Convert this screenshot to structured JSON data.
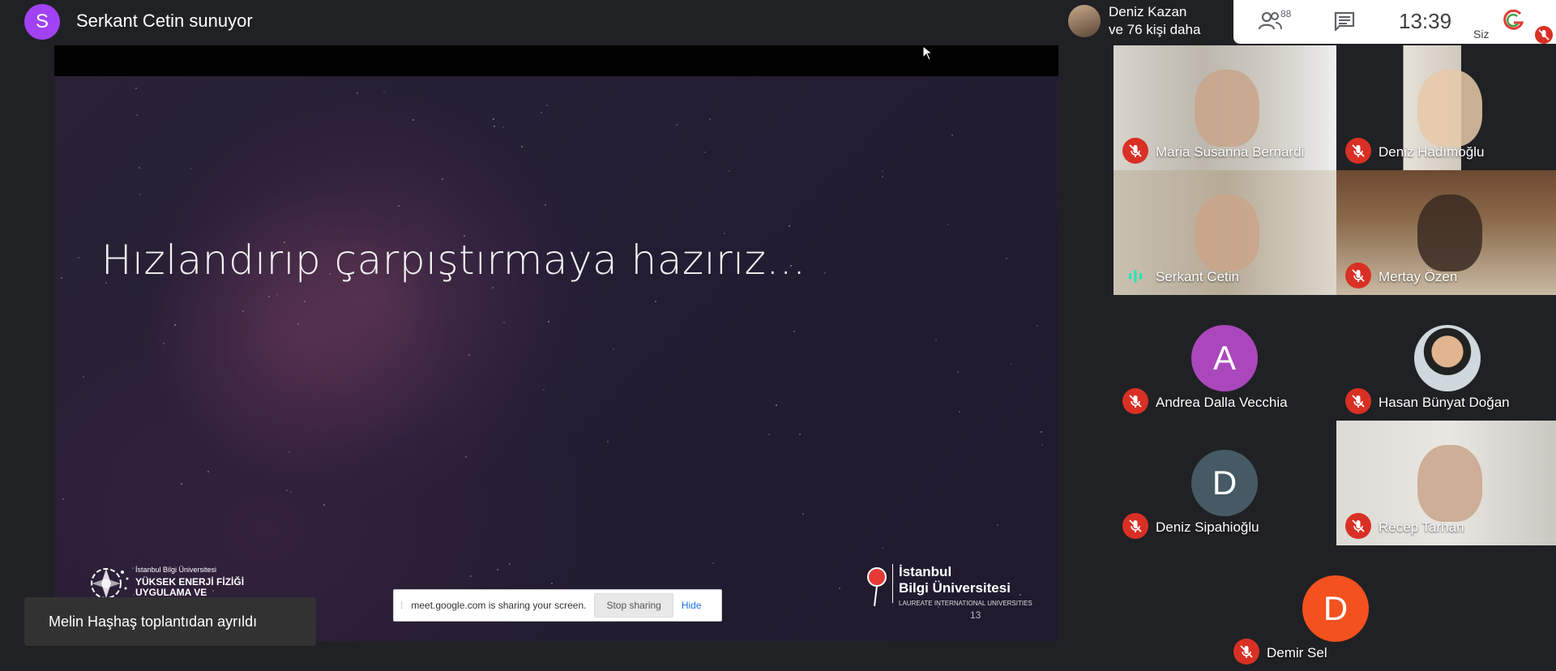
{
  "presenter": {
    "initial": "S",
    "title": "Serkant Cetin sunuyor"
  },
  "slide": {
    "heading": "Hızlandırıp çarpıştırmaya hazırız...",
    "left_logo": {
      "small": "İstanbul Bilgi Üniversitesi",
      "line1": "YÜKSEK ENERJİ FİZİĞİ",
      "line2": "UYGULAMA VE"
    },
    "right_logo": {
      "line1": "İstanbul",
      "line2": "Bilgi Üniversitesi",
      "line3": "LAUREATE INTERNATIONAL UNIVERSITIES"
    },
    "page_number": "13"
  },
  "share_bar": {
    "text": "meet.google.com is sharing your screen.",
    "stop_label": "Stop sharing",
    "hide_label": "Hide"
  },
  "toast": {
    "text": "Melin Haşhaş toplantıdan ayrıldı"
  },
  "header": {
    "top_participant": "Deniz Kazan",
    "more_label": "ve 76 kişi daha",
    "people_count": "88",
    "clock": "13:39",
    "self_label": "Siz"
  },
  "participants": [
    {
      "name": "Maria Susanna Bernardi",
      "muted": true,
      "kind": "video"
    },
    {
      "name": "Deniz Hadımoğlu",
      "muted": true,
      "kind": "video"
    },
    {
      "name": "Serkant Cetin",
      "muted": false,
      "kind": "video"
    },
    {
      "name": "Mertay Özen",
      "muted": true,
      "kind": "video"
    },
    {
      "name": "Andrea Dalla Vecchia",
      "muted": true,
      "kind": "letter",
      "initial": "A",
      "color": "#ab47bc"
    },
    {
      "name": "Hasan Bünyat Doğan",
      "muted": true,
      "kind": "photo"
    },
    {
      "name": "Deniz Sipahioğlu",
      "muted": true,
      "kind": "letter",
      "initial": "D",
      "color": "#455a64"
    },
    {
      "name": "Recep Tarhan",
      "muted": true,
      "kind": "video"
    },
    {
      "name": "Demir Sel",
      "muted": true,
      "kind": "letter",
      "initial": "D",
      "color": "#f4511e"
    }
  ],
  "colors": {
    "mute_red": "#d93025",
    "speaking_green": "#1de9b6",
    "background": "#202124"
  },
  "icons": [
    "people-icon",
    "chat-icon",
    "mic-off-icon",
    "audio-wave-icon",
    "cursor-icon"
  ]
}
